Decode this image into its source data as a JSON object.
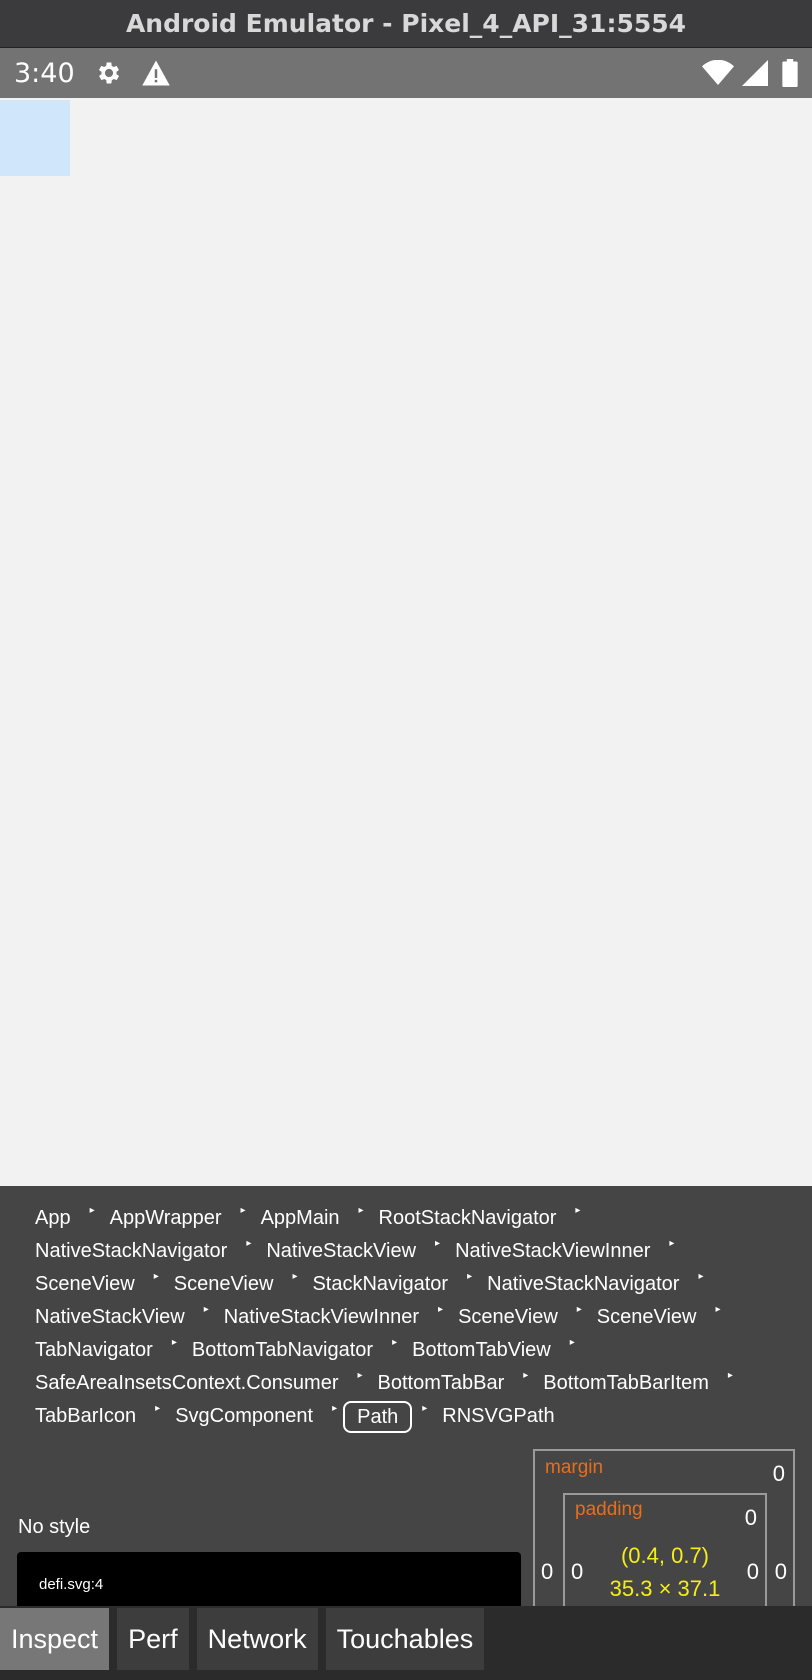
{
  "window": {
    "title": "Android Emulator - Pixel_4_API_31:5554"
  },
  "status_bar": {
    "time": "3:40",
    "left_icons": [
      "gear-icon",
      "warning-icon"
    ],
    "right_icons": [
      "wifi-icon",
      "signal-icon",
      "battery-icon"
    ]
  },
  "inspector": {
    "breadcrumbs": [
      "App",
      "AppWrapper",
      "AppMain",
      "RootStackNavigator",
      "NativeStackNavigator",
      "NativeStackView",
      "NativeStackViewInner",
      "SceneView",
      "SceneView",
      "StackNavigator",
      "NativeStackNavigator",
      "NativeStackView",
      "NativeStackViewInner",
      "SceneView",
      "SceneView",
      "TabNavigator",
      "BottomTabNavigator",
      "BottomTabView",
      "SafeAreaInsetsContext.Consumer",
      "BottomTabBar",
      "BottomTabBarItem",
      "TabBarIcon",
      "SvgComponent",
      "Path",
      "RNSVGPath"
    ],
    "selected_crumb": "Path",
    "no_style": "No style",
    "source": "defi.svg:4",
    "box_model": {
      "margin_label": "margin",
      "padding_label": "padding",
      "margin_top": "0",
      "margin_left": "0",
      "margin_right": "0",
      "padding_top": "0",
      "padding_left": "0",
      "padding_right": "0",
      "position": "(0.4, 0.7)",
      "size": "35.3 × 37.1"
    }
  },
  "tabs": [
    {
      "label": "Inspect",
      "active": true
    },
    {
      "label": "Perf",
      "active": false
    },
    {
      "label": "Network",
      "active": false
    },
    {
      "label": "Touchables",
      "active": false
    }
  ]
}
